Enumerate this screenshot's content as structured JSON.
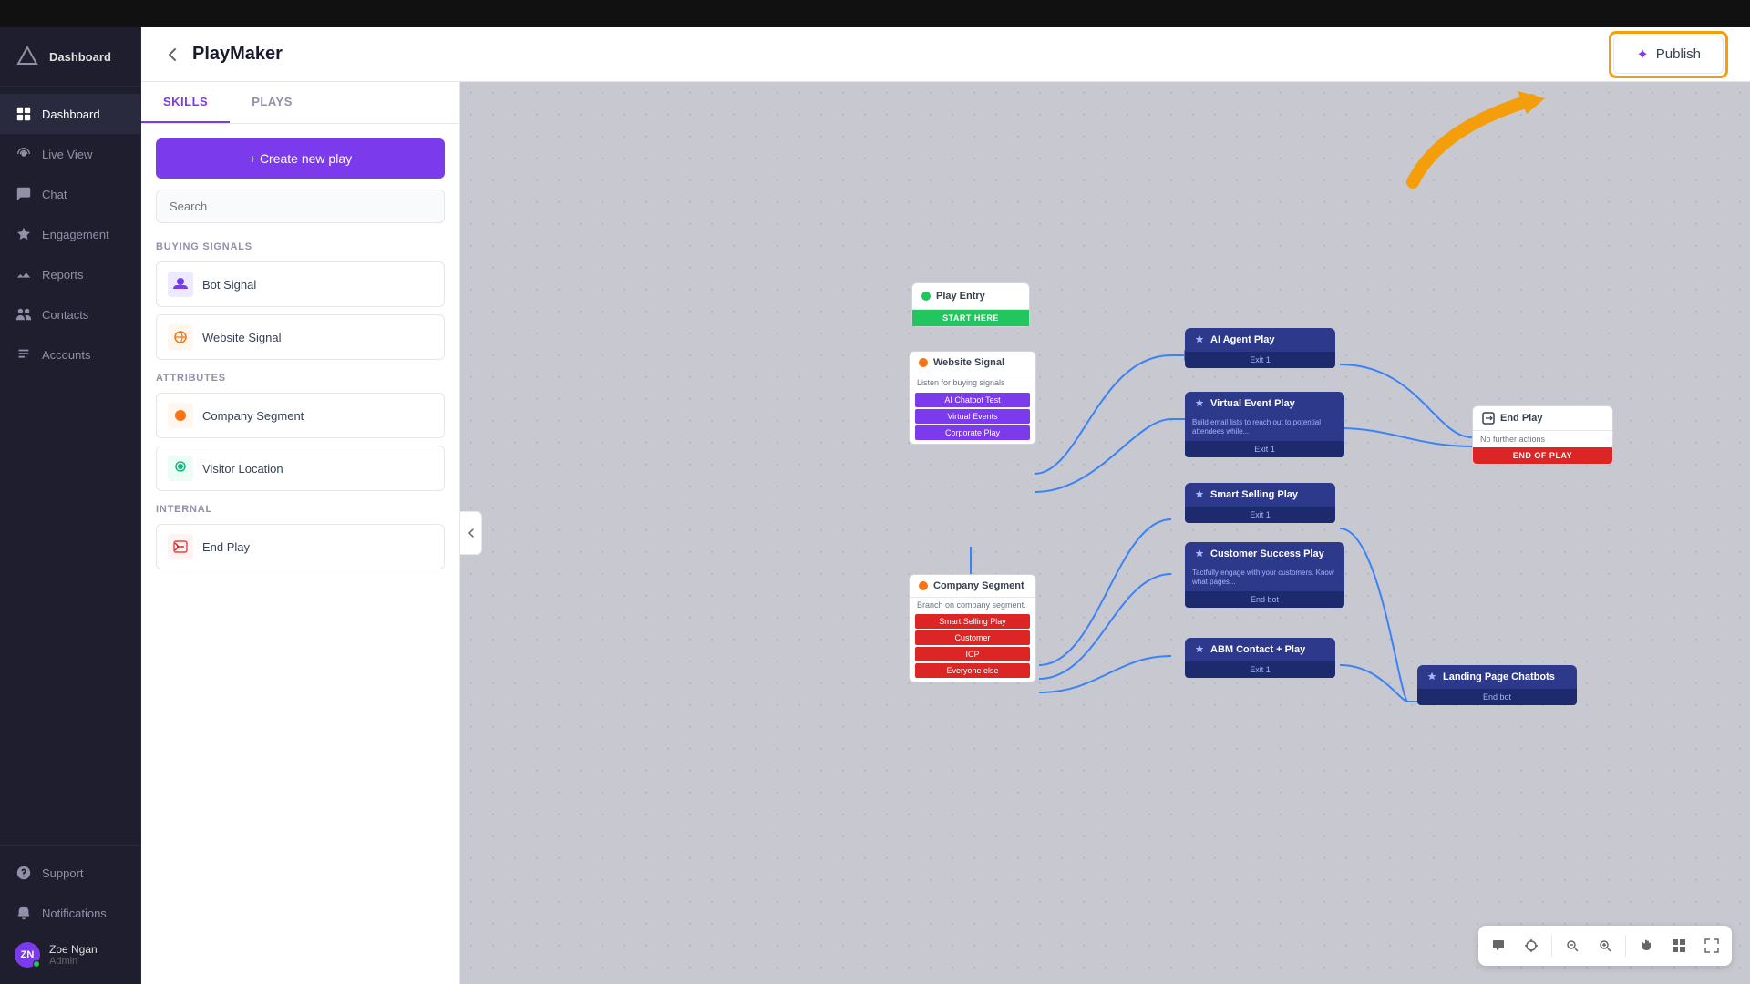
{
  "app": {
    "name": "Dashboard",
    "topbar_color": "#111111"
  },
  "sidebar": {
    "logo_text": "Λ",
    "items": [
      {
        "id": "dashboard",
        "label": "Dashboard",
        "active": true
      },
      {
        "id": "live-view",
        "label": "Live View",
        "active": false
      },
      {
        "id": "chat",
        "label": "Chat",
        "active": false
      },
      {
        "id": "engagement",
        "label": "Engagement",
        "active": false
      },
      {
        "id": "reports",
        "label": "Reports",
        "active": false
      },
      {
        "id": "contacts",
        "label": "Contacts",
        "active": false
      },
      {
        "id": "accounts",
        "label": "Accounts",
        "active": false
      }
    ],
    "bottom_items": [
      {
        "id": "support",
        "label": "Support"
      },
      {
        "id": "notifications",
        "label": "Notifications"
      }
    ],
    "user": {
      "name": "Zoe Ngan",
      "role": "Admin",
      "initials": "ZN"
    }
  },
  "header": {
    "title": "PlayMaker",
    "back_label": "←",
    "publish_label": "Publish"
  },
  "left_panel": {
    "tabs": [
      {
        "id": "skills",
        "label": "SKILLS",
        "active": true
      },
      {
        "id": "plays",
        "label": "PLAYS",
        "active": false
      }
    ],
    "create_button": "+ Create new play",
    "search_placeholder": "Search",
    "sections": [
      {
        "id": "buying-signals",
        "label": "BUYING SIGNALS",
        "items": [
          {
            "id": "bot-signal",
            "name": "Bot Signal",
            "icon_type": "purple"
          },
          {
            "id": "website-signal",
            "name": "Website Signal",
            "icon_type": "orange"
          }
        ]
      },
      {
        "id": "attributes",
        "label": "ATTRIBUTES",
        "items": [
          {
            "id": "company-segment",
            "name": "Company Segment",
            "icon_type": "orange"
          },
          {
            "id": "visitor-location",
            "name": "Visitor Location",
            "icon_type": "teal"
          }
        ]
      },
      {
        "id": "internal",
        "label": "INTERNAL",
        "items": [
          {
            "id": "end-play",
            "name": "End Play",
            "icon_type": "red"
          }
        ]
      }
    ]
  },
  "canvas": {
    "nodes": {
      "play_entry": {
        "title": "Play Entry",
        "start_label": "START HERE"
      },
      "website_signal": {
        "title": "Website Signal",
        "desc": "Listen for buying signals",
        "tags": [
          "AI Chatbot Test",
          "Virtual Events",
          "Corporate Play"
        ]
      },
      "ai_agent_play": {
        "title": "AI Agent Play",
        "exit": "Exit 1"
      },
      "virtual_event_play": {
        "title": "Virtual Event Play",
        "desc": "Build email lists to reach out to potential attendees while...",
        "exit": "Exit 1"
      },
      "smart_selling_play": {
        "title": "Smart Selling Play",
        "exit": "Exit 1"
      },
      "customer_success_play": {
        "title": "Customer Success Play",
        "desc": "Tactfully engage with your customers. Know what pages...",
        "exit": "End bot"
      },
      "abm_contact_play": {
        "title": "ABM Contact + Play",
        "exit": "Exit 1"
      },
      "landing_page_chatbots": {
        "title": "Landing Page Chatbots",
        "exit": "End bot"
      },
      "company_segment": {
        "title": "Company Segment",
        "desc": "Branch on company segment.",
        "tags": [
          "Smart Selling Play",
          "Customer",
          "ICP",
          "Everyone else"
        ]
      },
      "end_play": {
        "title": "End Play",
        "desc": "No further actions",
        "end_label": "END OF PLAY"
      }
    }
  },
  "toolbar": {
    "buttons": [
      "chat-bubble",
      "target",
      "zoom-out",
      "zoom-in",
      "hand",
      "grid",
      "fullscreen"
    ]
  }
}
